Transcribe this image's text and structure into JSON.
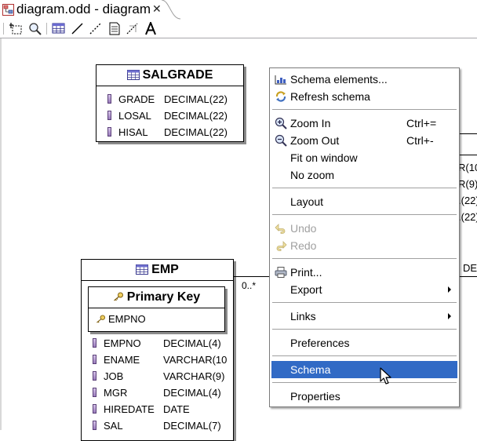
{
  "editor_tab": {
    "title": "diagram.odd - diagram",
    "close": "✕"
  },
  "palette": {
    "tools": [
      "marquee-select-icon",
      "zoom-icon",
      "table-tool-icon",
      "relation-tool-icon",
      "dashed-relation-tool-icon",
      "note-tool-icon",
      "note-link-tool-icon",
      "text-tool-icon"
    ]
  },
  "tables": {
    "salgrade": {
      "title": "SALGRADE",
      "columns": [
        {
          "name": "GRADE",
          "type": "DECIMAL(22)"
        },
        {
          "name": "LOSAL",
          "type": "DECIMAL(22)"
        },
        {
          "name": "HISAL",
          "type": "DECIMAL(22)"
        }
      ]
    },
    "emp": {
      "title": "EMP",
      "primary_key_title": "Primary Key",
      "primary_key_column": "EMPNO",
      "columns": [
        {
          "name": "EMPNO",
          "type": "DECIMAL(4)"
        },
        {
          "name": "ENAME",
          "type": "VARCHAR(10"
        },
        {
          "name": "JOB",
          "type": "VARCHAR(9)"
        },
        {
          "name": "MGR",
          "type": "DECIMAL(4)"
        },
        {
          "name": "HIREDATE",
          "type": "DATE"
        },
        {
          "name": "SAL",
          "type": "DECIMAL(7)"
        }
      ]
    },
    "partial": {
      "cells": [
        "R(10",
        "R(9)",
        ".(22)",
        ".(22)"
      ],
      "edge_label": "DE"
    }
  },
  "connection": {
    "multiplicity": "0..*"
  },
  "context_menu": {
    "items": {
      "schema_elements": "Schema elements...",
      "refresh_schema": "Refresh schema",
      "zoom_in": "Zoom In",
      "zoom_in_shortcut": "Ctrl+=",
      "zoom_out": "Zoom Out",
      "zoom_out_shortcut": "Ctrl+-",
      "fit_on_window": "Fit on window",
      "no_zoom": "No zoom",
      "layout": "Layout",
      "undo": "Undo",
      "redo": "Redo",
      "print": "Print...",
      "export": "Export",
      "links": "Links",
      "preferences": "Preferences",
      "schema": "Schema",
      "properties": "Properties"
    },
    "selected": "schema",
    "disabled": [
      "undo",
      "redo"
    ],
    "selection_color": "#316ac5"
  }
}
